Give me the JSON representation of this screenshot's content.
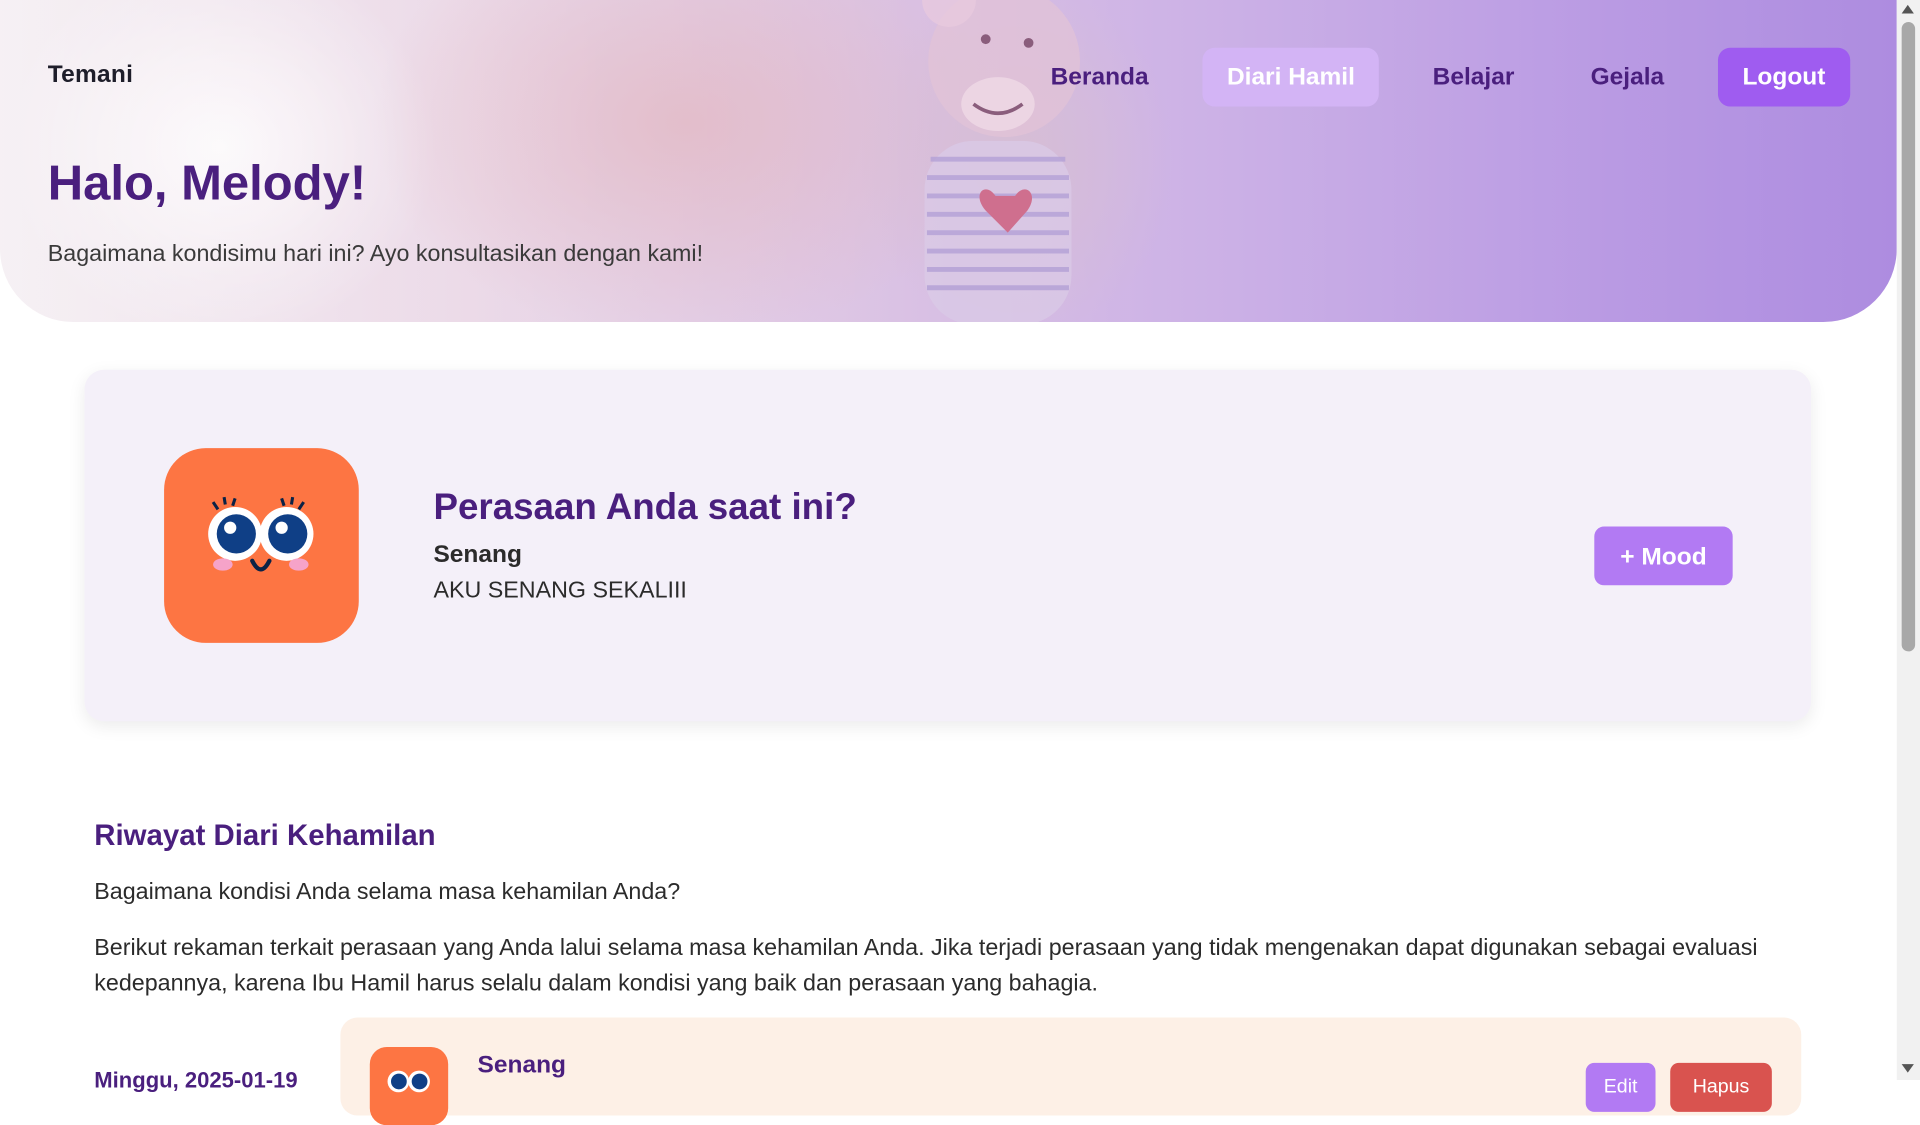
{
  "brand": "Temani",
  "nav": {
    "items": [
      {
        "label": "Beranda",
        "active": false
      },
      {
        "label": "Diari Hamil",
        "active": true
      },
      {
        "label": "Belajar",
        "active": false
      },
      {
        "label": "Gejala",
        "active": false
      }
    ],
    "logout": "Logout"
  },
  "hero": {
    "title": "Halo, Melody!",
    "subtitle": "Bagaimana kondisimu hari ini? Ayo konsultasikan dengan kami!"
  },
  "mood_card": {
    "question": "Perasaan Anda saat ini?",
    "mood": "Senang",
    "note": "AKU SENANG SEKALIII",
    "add_button": "+ Mood",
    "icon": "happy-face-icon",
    "icon_color": "#fd7543"
  },
  "history": {
    "title": "Riwayat Diari Kehamilan",
    "question": "Bagaimana kondisi Anda selama masa kehamilan Anda?",
    "description": "Berikut rekaman terkait perasaan yang Anda lalui selama masa kehamilan Anda. Jika terjadi perasaan yang tidak mengenakan dapat digunakan sebagai evaluasi kedepannya, karena Ibu Hamil harus selalu dalam kondisi yang baik dan perasaan yang bahagia.",
    "entries": [
      {
        "date": "Minggu, 2025-01-19",
        "mood": "Senang",
        "edit": "Edit",
        "delete": "Hapus"
      }
    ]
  },
  "colors": {
    "accent_purple": "#4a1f7e",
    "button_purple": "#b27af3",
    "logout_purple": "#9f5cf0",
    "active_nav": "#d3b4f5",
    "mood_orange": "#fd7543",
    "delete_red": "#d9534f"
  }
}
